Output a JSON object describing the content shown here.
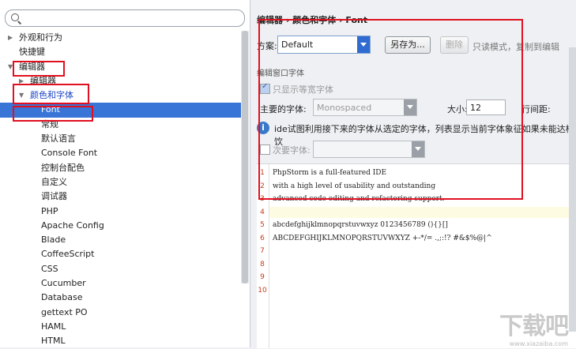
{
  "sidebar": {
    "search_placeholder": "",
    "items": [
      {
        "label": "外观和行为",
        "arrow": "▶"
      },
      {
        "label": "快捷键",
        "arrow": ""
      },
      {
        "label": "编辑器",
        "arrow": "▼"
      },
      {
        "label": "编辑器",
        "arrow": "▶"
      },
      {
        "label": "颜色和字体",
        "arrow": "▼"
      },
      {
        "label": "Font",
        "arrow": ""
      },
      {
        "label": "常规",
        "arrow": ""
      },
      {
        "label": "默认语言",
        "arrow": ""
      },
      {
        "label": "Console Font",
        "arrow": ""
      },
      {
        "label": "控制台配色",
        "arrow": ""
      },
      {
        "label": "自定义",
        "arrow": ""
      },
      {
        "label": "调试器",
        "arrow": ""
      },
      {
        "label": "PHP",
        "arrow": ""
      },
      {
        "label": "Apache Config",
        "arrow": ""
      },
      {
        "label": "Blade",
        "arrow": ""
      },
      {
        "label": "CoffeeScript",
        "arrow": ""
      },
      {
        "label": "CSS",
        "arrow": ""
      },
      {
        "label": "Cucumber",
        "arrow": ""
      },
      {
        "label": "Database",
        "arrow": ""
      },
      {
        "label": "gettext PO",
        "arrow": ""
      },
      {
        "label": "HAML",
        "arrow": ""
      },
      {
        "label": "HTML",
        "arrow": ""
      }
    ]
  },
  "main": {
    "breadcrumb": "编辑器 › 颜色和字体 › Font",
    "scheme_label": "方案:",
    "scheme_value": "Default",
    "save_as_label": "另存为...",
    "delete_label": "删除",
    "readonly_note": "只读模式，复制到编辑",
    "section_title": "编辑窗口字体",
    "monospace_only_label": "只显示等宽字体",
    "primary_font_label": "主要的字体:",
    "primary_font_value": "Monospaced",
    "size_label": "大小:",
    "size_value": "12",
    "line_spacing_label": "行间距:",
    "info_text": "ide试图利用接下来的字体从选定的字体，列表显示当前字体象征如果未能达样饮",
    "secondary_font_label": "次要字体:",
    "preview": {
      "line_numbers": [
        "1",
        "2",
        "3",
        "4",
        "5",
        "6",
        "7",
        "8",
        "9",
        "10"
      ],
      "lines": [
        "PhpStorm is a full-featured IDE",
        "with a high level of usability and outstanding",
        "advanced code editing and refactoring support.",
        "",
        "abcdefghijklmnopqrstuvwxyz 0123456789 (){}[]",
        "ABCDEFGHIJKLMNOPQRSTUVWXYZ +-*/= .,;:!? #&$%@|^",
        "",
        "",
        "",
        ""
      ]
    }
  },
  "watermark": {
    "text": "下载吧",
    "sub": "www.xiazaiba.com"
  },
  "colors": {
    "selection": "#3875d7",
    "highlight_box": "#e01020",
    "link_blue": "#1a43c8"
  }
}
